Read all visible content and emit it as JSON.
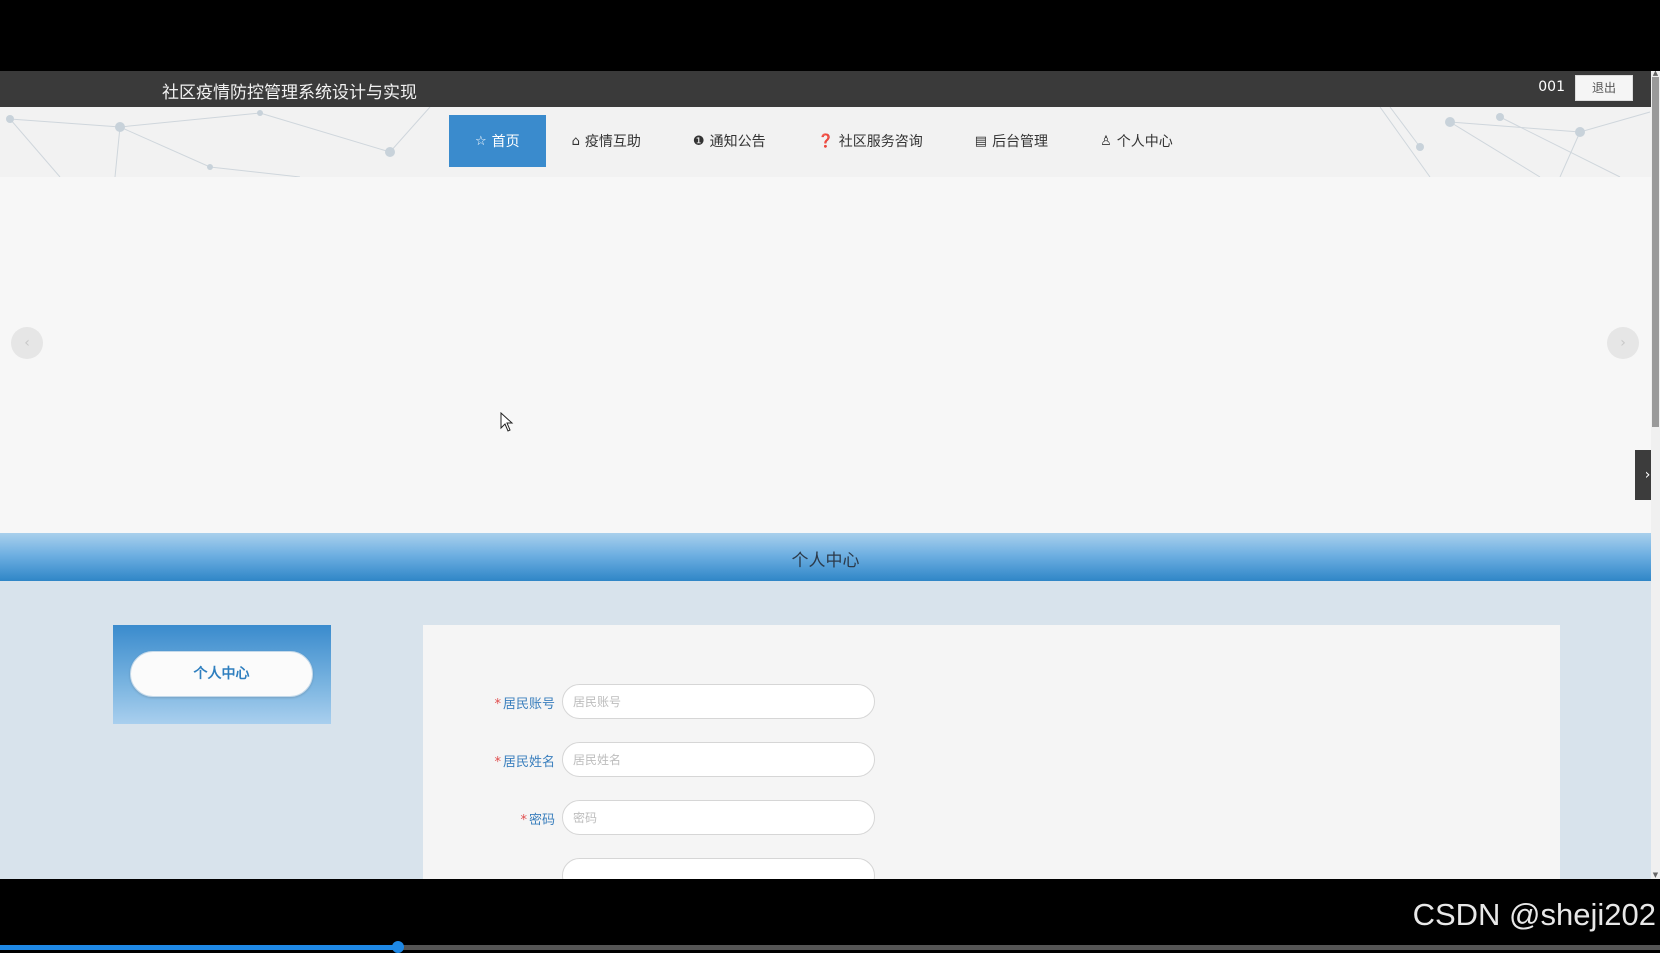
{
  "header": {
    "title": "社区疫情防控管理系统设计与实现",
    "user": "001",
    "logout_label": "退出"
  },
  "nav": {
    "items": [
      {
        "label": "首页",
        "icon": "☆",
        "icon_name": "star-icon",
        "active": true
      },
      {
        "label": "疫情互助",
        "icon": "⌂",
        "icon_name": "bag-icon",
        "active": false
      },
      {
        "label": "通知公告",
        "icon": "❶",
        "icon_name": "exclamation-circle-icon",
        "active": false
      },
      {
        "label": "社区服务咨询",
        "icon": "❓",
        "icon_name": "question-circle-icon",
        "active": false
      },
      {
        "label": "后台管理",
        "icon": "▤",
        "icon_name": "calendar-icon",
        "active": false
      },
      {
        "label": "个人中心",
        "icon": "♙",
        "icon_name": "user-icon",
        "active": false
      }
    ]
  },
  "carousel": {
    "prev_icon": "‹",
    "next_icon": "›"
  },
  "side_tab": {
    "icon": "›"
  },
  "section": {
    "title": "个人中心"
  },
  "side_panel": {
    "button_label": "个人中心"
  },
  "form": {
    "fields": [
      {
        "label": "居民账号",
        "required": true,
        "placeholder": "居民账号",
        "value": ""
      },
      {
        "label": "居民姓名",
        "required": true,
        "placeholder": "居民姓名",
        "value": ""
      },
      {
        "label": "密码",
        "required": true,
        "placeholder": "密码",
        "value": ""
      },
      {
        "label": "",
        "required": false,
        "placeholder": "",
        "value": ""
      }
    ]
  },
  "watermark": "CSDN @sheji202",
  "video_progress": 0.24,
  "colors": {
    "accent": "#3a8bcd",
    "topbar": "#3a3a3a",
    "required": "#e04c4c",
    "label": "#3a7fbd"
  }
}
